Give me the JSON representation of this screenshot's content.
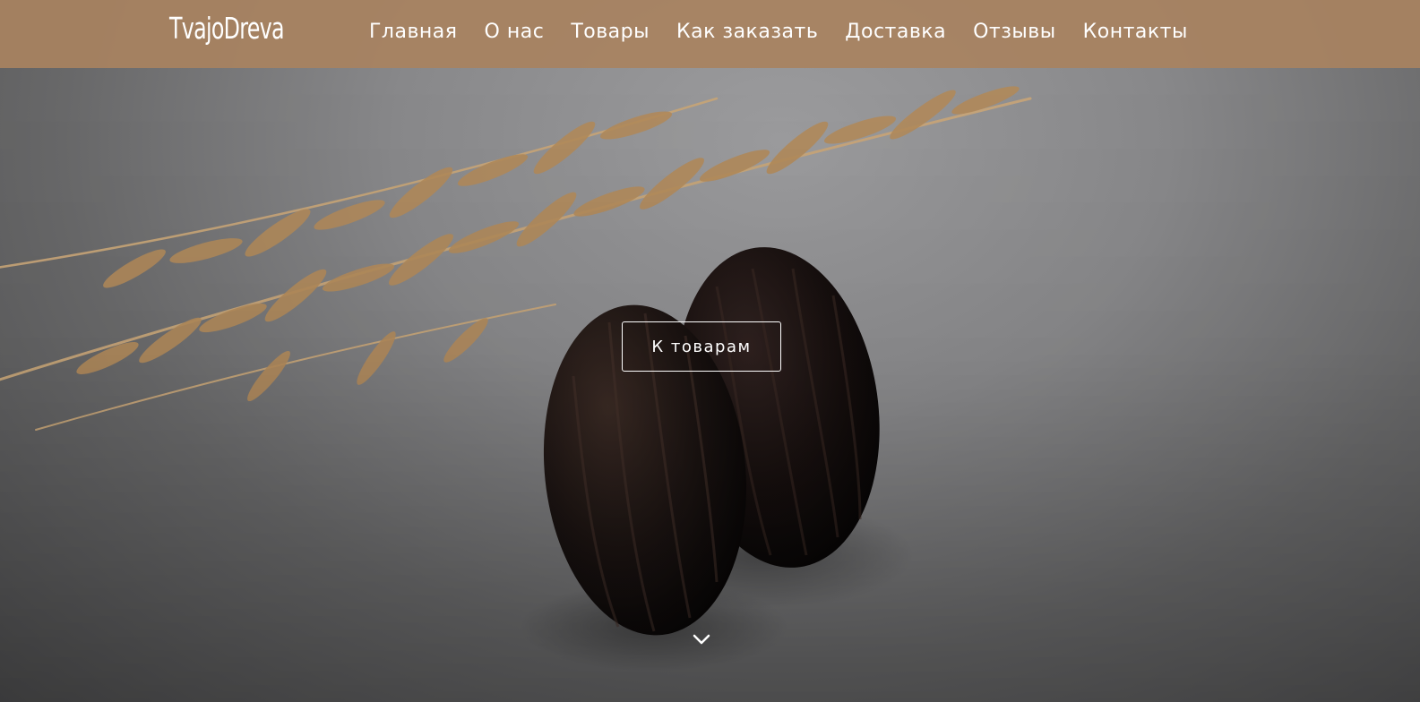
{
  "header": {
    "logo_text": "TvajoDreva",
    "nav": [
      {
        "label": "Главная"
      },
      {
        "label": "О нас"
      },
      {
        "label": "Товары"
      },
      {
        "label": "Как заказать"
      },
      {
        "label": "Доставка"
      },
      {
        "label": "Отзывы"
      },
      {
        "label": "Контакты"
      }
    ]
  },
  "hero": {
    "button_label": "К товарам",
    "scroll_icon": "chevron-down-icon",
    "image_subject": "wooden-earrings-with-dried-grass"
  },
  "colors": {
    "navbar_bg": "#a88260",
    "text": "#ffffff"
  }
}
